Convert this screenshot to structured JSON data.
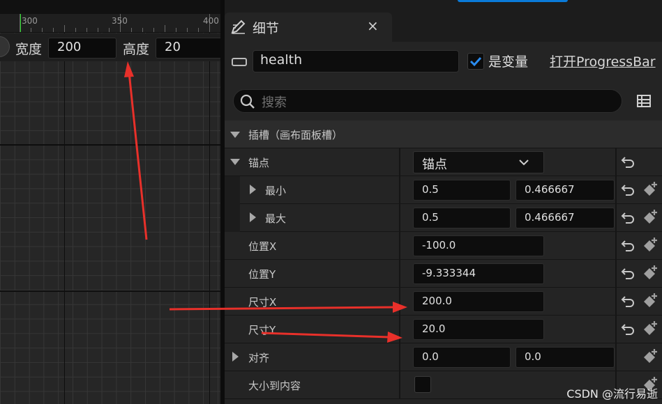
{
  "viewport": {
    "ruler_ticks": [
      "300",
      "350",
      "400"
    ],
    "width_label": "宽度",
    "width_value": "200",
    "height_label": "高度",
    "height_value": "20"
  },
  "details": {
    "tab_title": "细节",
    "tab_close": "×",
    "widget_name": "health",
    "is_variable_label": "是变量",
    "is_variable_checked": true,
    "open_link": "打开ProgressBar",
    "search_placeholder": "搜索",
    "section_title": "插槽（画布面板槽）",
    "anchors_label": "锚点",
    "anchors_dropdown": "锚点",
    "min_label": "最小",
    "min_x": "0.5",
    "min_y": "0.466667",
    "max_label": "最大",
    "max_x": "0.5",
    "max_y": "0.466667",
    "pos_x_label": "位置X",
    "pos_x_value": "-100.0",
    "pos_y_label": "位置Y",
    "pos_y_value": "-9.333344",
    "size_x_label": "尺寸X",
    "size_x_value": "200.0",
    "size_y_label": "尺寸Y",
    "size_y_value": "20.0",
    "alignment_label": "对齐",
    "alignment_x": "0.0",
    "alignment_y": "0.0",
    "size_to_content_label": "大小到内容",
    "size_to_content_checked": false
  },
  "watermark": "CSDN @流行易逝",
  "colors": {
    "accent_blue": "#0a7ad8",
    "check_blue": "#2a8cf0",
    "annotation_red": "#e8302a",
    "ruler_marker_green": "#28d828"
  }
}
